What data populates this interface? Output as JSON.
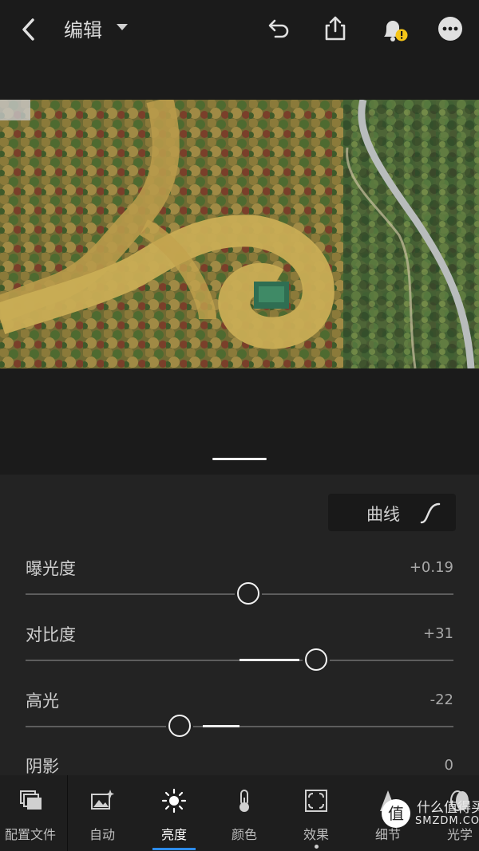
{
  "header": {
    "title": "编辑"
  },
  "curve_button": {
    "label": "曲线"
  },
  "sliders": [
    {
      "label": "曝光度",
      "value": "+0.19",
      "position": 0.52
    },
    {
      "label": "对比度",
      "value": "+31",
      "position": 0.68
    },
    {
      "label": "高光",
      "value": "-22",
      "position": 0.36
    },
    {
      "label": "阴影",
      "value": "0"
    }
  ],
  "toolbar": {
    "items": [
      {
        "label": "配置文件",
        "icon": "profiles-icon"
      },
      {
        "label": "自动",
        "icon": "auto-icon"
      },
      {
        "label": "亮度",
        "icon": "light-icon",
        "active": true
      },
      {
        "label": "颜色",
        "icon": "color-icon"
      },
      {
        "label": "效果",
        "icon": "effects-icon"
      },
      {
        "label": "细节",
        "icon": "detail-icon"
      },
      {
        "label": "光学",
        "icon": "optics-icon"
      }
    ]
  },
  "watermark": {
    "line1": "什么值得买",
    "line2": "SMZDM.COM",
    "badge": "值"
  },
  "colors": {
    "accent": "#2d8ceb",
    "background": "#1b1b1b",
    "panel": "#232323",
    "warning": "#f5c518"
  }
}
